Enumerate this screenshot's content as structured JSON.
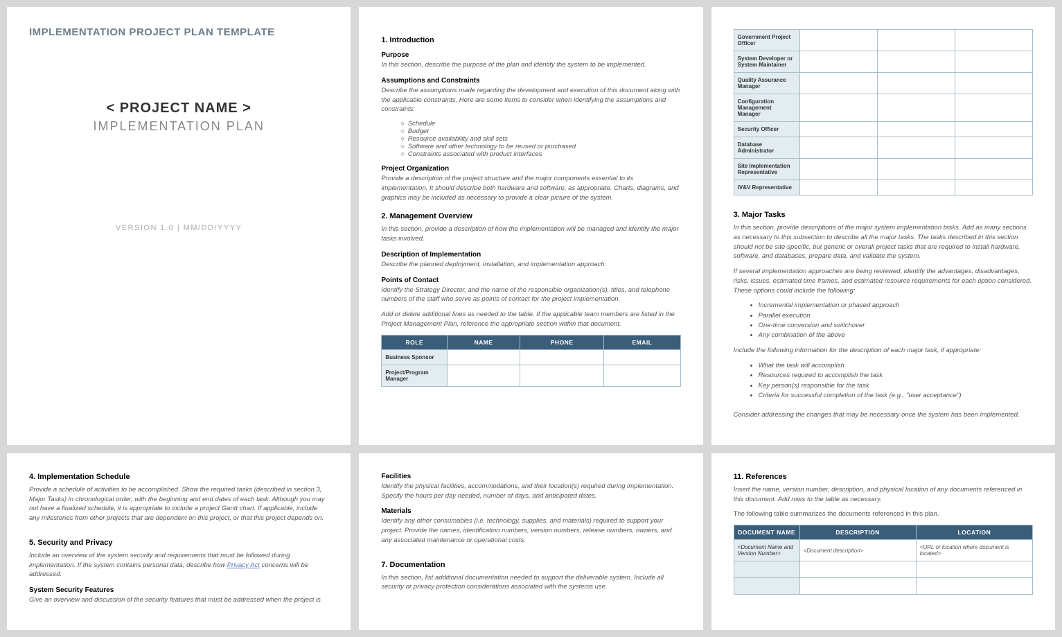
{
  "page1": {
    "template_header": "IMPLEMENTATION PROJECT PLAN TEMPLATE",
    "project_name": "< PROJECT NAME >",
    "subtitle": "IMPLEMENTATION PLAN",
    "version_line": "VERSION 1.0  |  MM/DD/YYYY"
  },
  "page2": {
    "s1_title": "1. Introduction",
    "purpose_h": "Purpose",
    "purpose_d": "In this section, describe the purpose of the plan and identify the system to be implemented.",
    "assump_h": "Assumptions and Constraints",
    "assump_d": "Describe the assumptions made regarding the development and execution of this document along with the applicable constraints. Here are some items to consider when identifying the assumptions and constraints:",
    "assump_list": [
      "Schedule",
      "Budget",
      "Resource availability and skill sets",
      "Software and other technology to be reused or purchased",
      "Constraints associated with product interfaces"
    ],
    "org_h": "Project Organization",
    "org_d": "Provide a description of the project structure and the major components essential to its implementation. It should describe both hardware and software, as appropriate. Charts, diagrams, and graphics may be included as necessary to provide a clear picture of the system.",
    "s2_title": "2. Management Overview",
    "s2_d": "In this section, provide a description of how the implementation will be managed and identify the major tasks involved.",
    "desc_h": "Description of Implementation",
    "desc_d": "Describe the planned deployment, installation, and implementation approach.",
    "poc_h": "Points of Contact",
    "poc_d1": "Identify the Strategy Director, and the name of the responsible organization(s), titles, and telephone numbers of the staff who serve as points of contact for the project implementation.",
    "poc_d2": "Add or delete additional lines as needed to the table. If the applicable team members are listed in the Project Management Plan, reference the appropriate section within that document.",
    "table_headers": [
      "ROLE",
      "NAME",
      "PHONE",
      "EMAIL"
    ],
    "table_roles_p2": [
      "Business Sponsor",
      "Project/Program Manager"
    ]
  },
  "page3": {
    "roles": [
      "Government Project Officer",
      "System Developer or System Maintainer",
      "Quality Assurance Manager",
      "Configuration Management Manager",
      "Security Officer",
      "Database Administrator",
      "Site Implementation Representative",
      "IV&V Representative"
    ],
    "s3_title": "3. Major Tasks",
    "s3_d1": "In this section, provide descriptions of the major system implementation tasks. Add as many sections as necessary to this subsection to describe all the major tasks. The tasks described in this section should not be site-specific, but generic or overall project tasks that are required to install hardware, software, and databases, prepare data, and validate the system.",
    "s3_d2": "If several implementation approaches are being reviewed, identify the advantages, disadvantages, risks, issues, estimated time frames, and estimated resource requirements for each option considered. These options could include the following:",
    "s3_list1": [
      "Incremental implementation or phased approach",
      "Parallel execution",
      "One-time conversion and switchover",
      "Any combination of the above"
    ],
    "s3_d3": "Include the following information for the description of each major task, if appropriate:",
    "s3_list2": [
      "What the task will accomplish",
      "Resources required to accomplish the task",
      "Key person(s) responsible for the task",
      "Criteria for successful completion of the task (e.g., \"user acceptance\")"
    ],
    "s3_d4": "Consider addressing the changes that may be necessary once the system has been implemented."
  },
  "page4": {
    "s4_title": "4. Implementation Schedule",
    "s4_d": "Provide a schedule of activities to be accomplished. Show the required tasks (described in section 3, Major Tasks) in chronological order, with the beginning and end dates of each task. Although you may not have a finalized schedule, it is appropriate to include a project Gantt chart. If applicable, include any milestones from other projects that are dependent on this project, or that this project depends on.",
    "s5_title": "5. Security and Privacy",
    "s5_d_pre": "Include an overview of the system security and requirements that must be followed during implementation. If the system contains personal data, describe how ",
    "s5_link": "Privacy Act",
    "s5_d_post": " concerns will be addressed.",
    "ssf_h": "System Security Features",
    "ssf_d": "Give an overview and discussion of the security features that must be addressed when the project is"
  },
  "page5": {
    "fac_h": "Facilities",
    "fac_d": "Identify the physical facilities, accommodations, and their location(s) required during implementation. Specify the hours per day needed, number of days, and anticipated dates.",
    "mat_h": "Materials",
    "mat_d": "Identify any other consumables (i.e. technology, supplies, and materials) required to support your project. Provide the names, identification numbers, version numbers, release numbers, owners, and any associated maintenance or operational costs.",
    "s7_title": "7. Documentation",
    "s7_d": "In this section, list additional documentation needed to support the deliverable system. Include all security or privacy protection considerations associated with the systems use."
  },
  "page6": {
    "s11_title": "11. References",
    "s11_d1": "Insert the name, version number, description, and physical location of any documents referenced in this document.  Add rows to the table as necessary.",
    "s11_d2": "The following table summarizes the documents referenced in this plan.",
    "ref_headers": [
      "DOCUMENT NAME",
      "DESCRIPTION",
      "LOCATION"
    ],
    "ref_cells": [
      "<Document Name and Version Number>",
      "<Document description>",
      "<URL or location where document is located>"
    ]
  }
}
